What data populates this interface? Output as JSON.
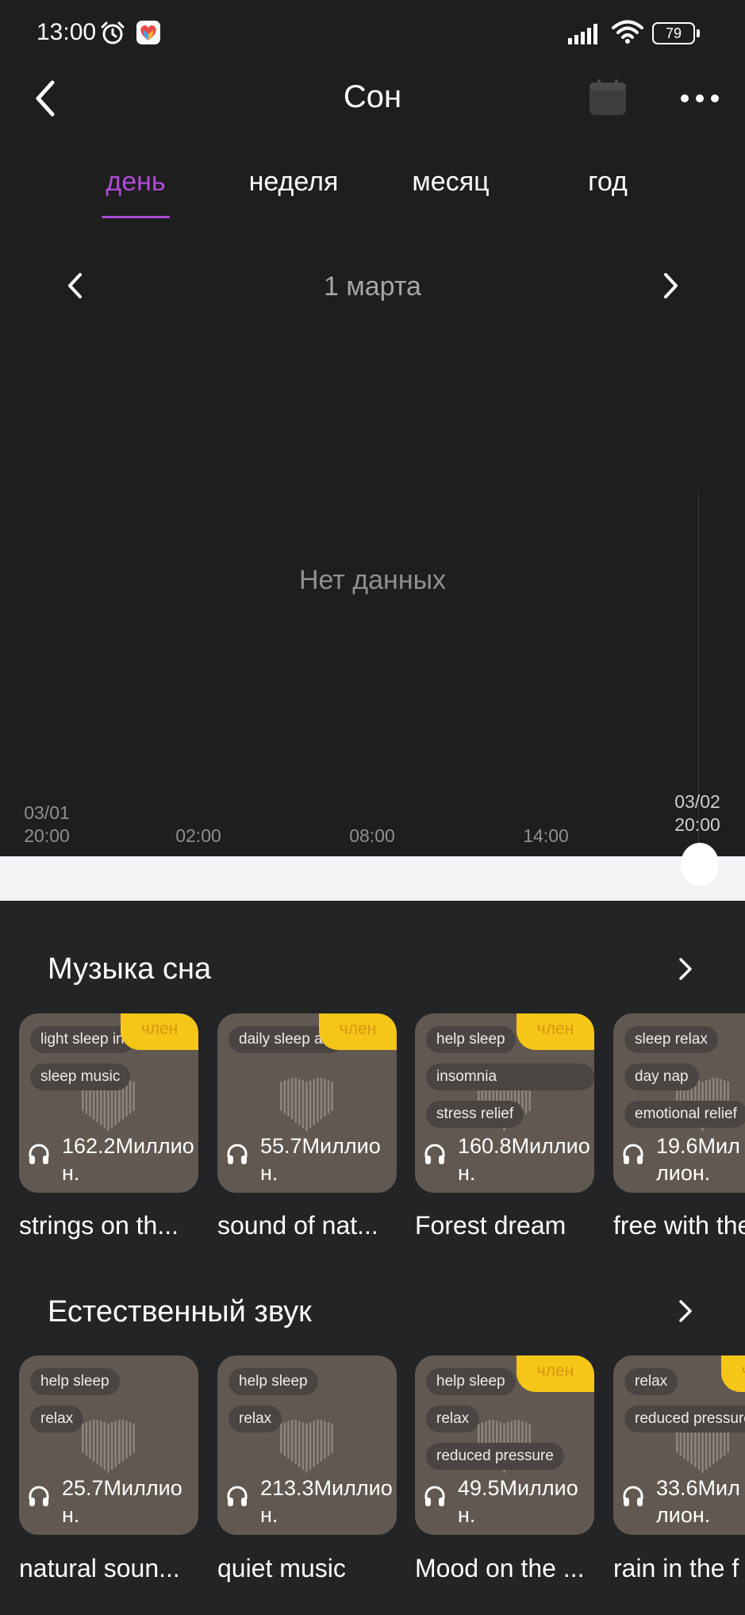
{
  "status": {
    "time": "13:00",
    "battery": "79"
  },
  "header": {
    "title": "Сон"
  },
  "tabs": [
    {
      "label": "день",
      "active": true
    },
    {
      "label": "неделя",
      "active": false
    },
    {
      "label": "месяц",
      "active": false
    },
    {
      "label": "год",
      "active": false
    }
  ],
  "date": {
    "label": "1 марта"
  },
  "chart": {
    "empty_text": "Нет данных",
    "x_ticks": [
      {
        "line1": "03/01",
        "line2": "20:00"
      },
      {
        "line1": "",
        "line2": "02:00"
      },
      {
        "line1": "",
        "line2": "08:00"
      },
      {
        "line1": "",
        "line2": "14:00"
      },
      {
        "line1": "03/02",
        "line2": "20:00"
      }
    ]
  },
  "sections": [
    {
      "title": "Музыка сна",
      "cards": [
        {
          "tags": [
            "light sleep in",
            "sleep music"
          ],
          "badge": "член",
          "plays": "162.2Миллион.",
          "title": "strings on th..."
        },
        {
          "tags": [
            "daily sleep aid"
          ],
          "badge": "член",
          "plays": "55.7Миллион.",
          "title": "sound of nat..."
        },
        {
          "tags": [
            "help sleep",
            "insomnia",
            "stress relief"
          ],
          "badge": "член",
          "plays": "160.8Миллион.",
          "title": "Forest dream"
        },
        {
          "tags": [
            "sleep relax",
            "day nap",
            "emotional relief"
          ],
          "badge": "",
          "plays": "19.6Миллион.",
          "title": "free with the"
        }
      ]
    },
    {
      "title": "Естественный звук",
      "cards": [
        {
          "tags": [
            "help sleep",
            "relax"
          ],
          "badge": "",
          "plays": "25.7Миллион.",
          "title": "natural soun..."
        },
        {
          "tags": [
            "help sleep",
            "relax"
          ],
          "badge": "",
          "plays": "213.3Миллион.",
          "title": "quiet music"
        },
        {
          "tags": [
            "help sleep",
            "relax",
            "reduced pressure"
          ],
          "badge": "член",
          "plays": "49.5Миллион.",
          "title": "Mood on the ..."
        },
        {
          "tags": [
            "relax",
            "reduced pressure"
          ],
          "badge": "член",
          "plays": "33.6Миллион.",
          "title": "rain in the f"
        }
      ]
    }
  ],
  "colors": {
    "accent": "#b04ad6",
    "badge": "#f5c518",
    "card": "#615951"
  }
}
